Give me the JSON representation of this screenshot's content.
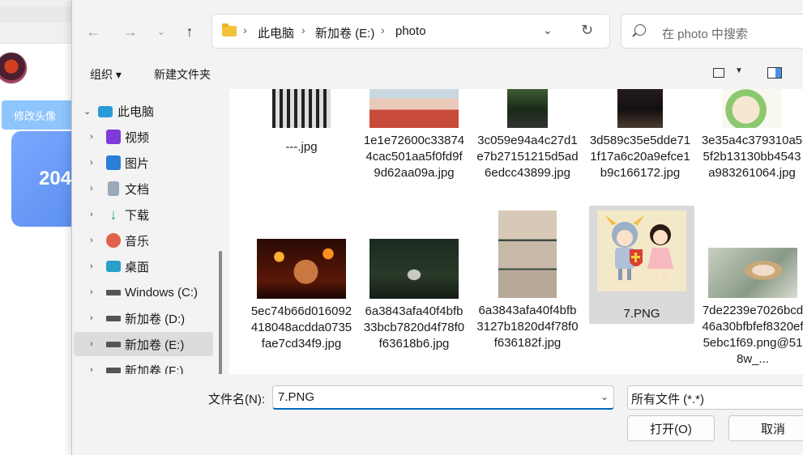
{
  "background": {
    "button_label": "修改头像",
    "card_number": "204"
  },
  "address": {
    "breadcrumb": [
      "此电脑",
      "新加卷 (E:)",
      "photo"
    ],
    "search_placeholder": "在 photo 中搜索"
  },
  "command_bar": {
    "organize": "组织 ▾",
    "new_folder": "新建文件夹"
  },
  "nav_tree": [
    {
      "label": "此电脑",
      "icon": "computer-icon",
      "expanded": true
    },
    {
      "label": "视频",
      "icon": "video-folder-icon"
    },
    {
      "label": "图片",
      "icon": "pictures-folder-icon"
    },
    {
      "label": "文档",
      "icon": "documents-folder-icon"
    },
    {
      "label": "下载",
      "icon": "download-folder-icon"
    },
    {
      "label": "音乐",
      "icon": "music-folder-icon"
    },
    {
      "label": "桌面",
      "icon": "desktop-folder-icon"
    },
    {
      "label": "Windows (C:)",
      "icon": "drive-icon"
    },
    {
      "label": "新加卷 (D:)",
      "icon": "drive-icon"
    },
    {
      "label": "新加卷 (E:)",
      "icon": "drive-icon",
      "selected": true
    },
    {
      "label": "新加卷 (F:)",
      "icon": "drive-icon"
    }
  ],
  "files": [
    {
      "name": "---.jpg",
      "theme": "bw-grid"
    },
    {
      "name": "1e1e72600c338744cac501aa5f0fd9f9d62aa09a.jpg",
      "theme": "room"
    },
    {
      "name": "3c059e94a4c27d1e7b27151215d5ad6edcc43899.jpg",
      "theme": "forest"
    },
    {
      "name": "3d589c35e5dde711f17a6c20a9efce1b9c166172.jpg",
      "theme": "dark"
    },
    {
      "name": "3e35a4c379310a55f2b13130bb4543a983261064.jpg",
      "theme": "cartoon-green"
    },
    {
      "name": "5ec74b66d016092418048acdda0735fae7cd34f9.jpg",
      "theme": "fire"
    },
    {
      "name": "6a3843afa40f4bfb33bcb7820d4f78f0f63618b6.jpg",
      "theme": "night-forest"
    },
    {
      "name": "6a3843afa40f4bfb3127b1820d4f78f0f636182f.jpg",
      "theme": "kiss"
    },
    {
      "name": "7.PNG",
      "theme": "cartoon-knight",
      "selected": true
    },
    {
      "name": "7de2239e7026bcd46a30bfbfef8320ef5ebc1f69.png@518w_...",
      "theme": "anime-boy"
    }
  ],
  "footer": {
    "filename_label": "文件名(N):",
    "filename_value": "7.PNG",
    "filetype_value": "所有文件 (*.*)",
    "open_button": "打开(O)",
    "cancel_button": "取消"
  },
  "colors": {
    "accent": "#0067c0",
    "selection": "#d9d9d9"
  }
}
